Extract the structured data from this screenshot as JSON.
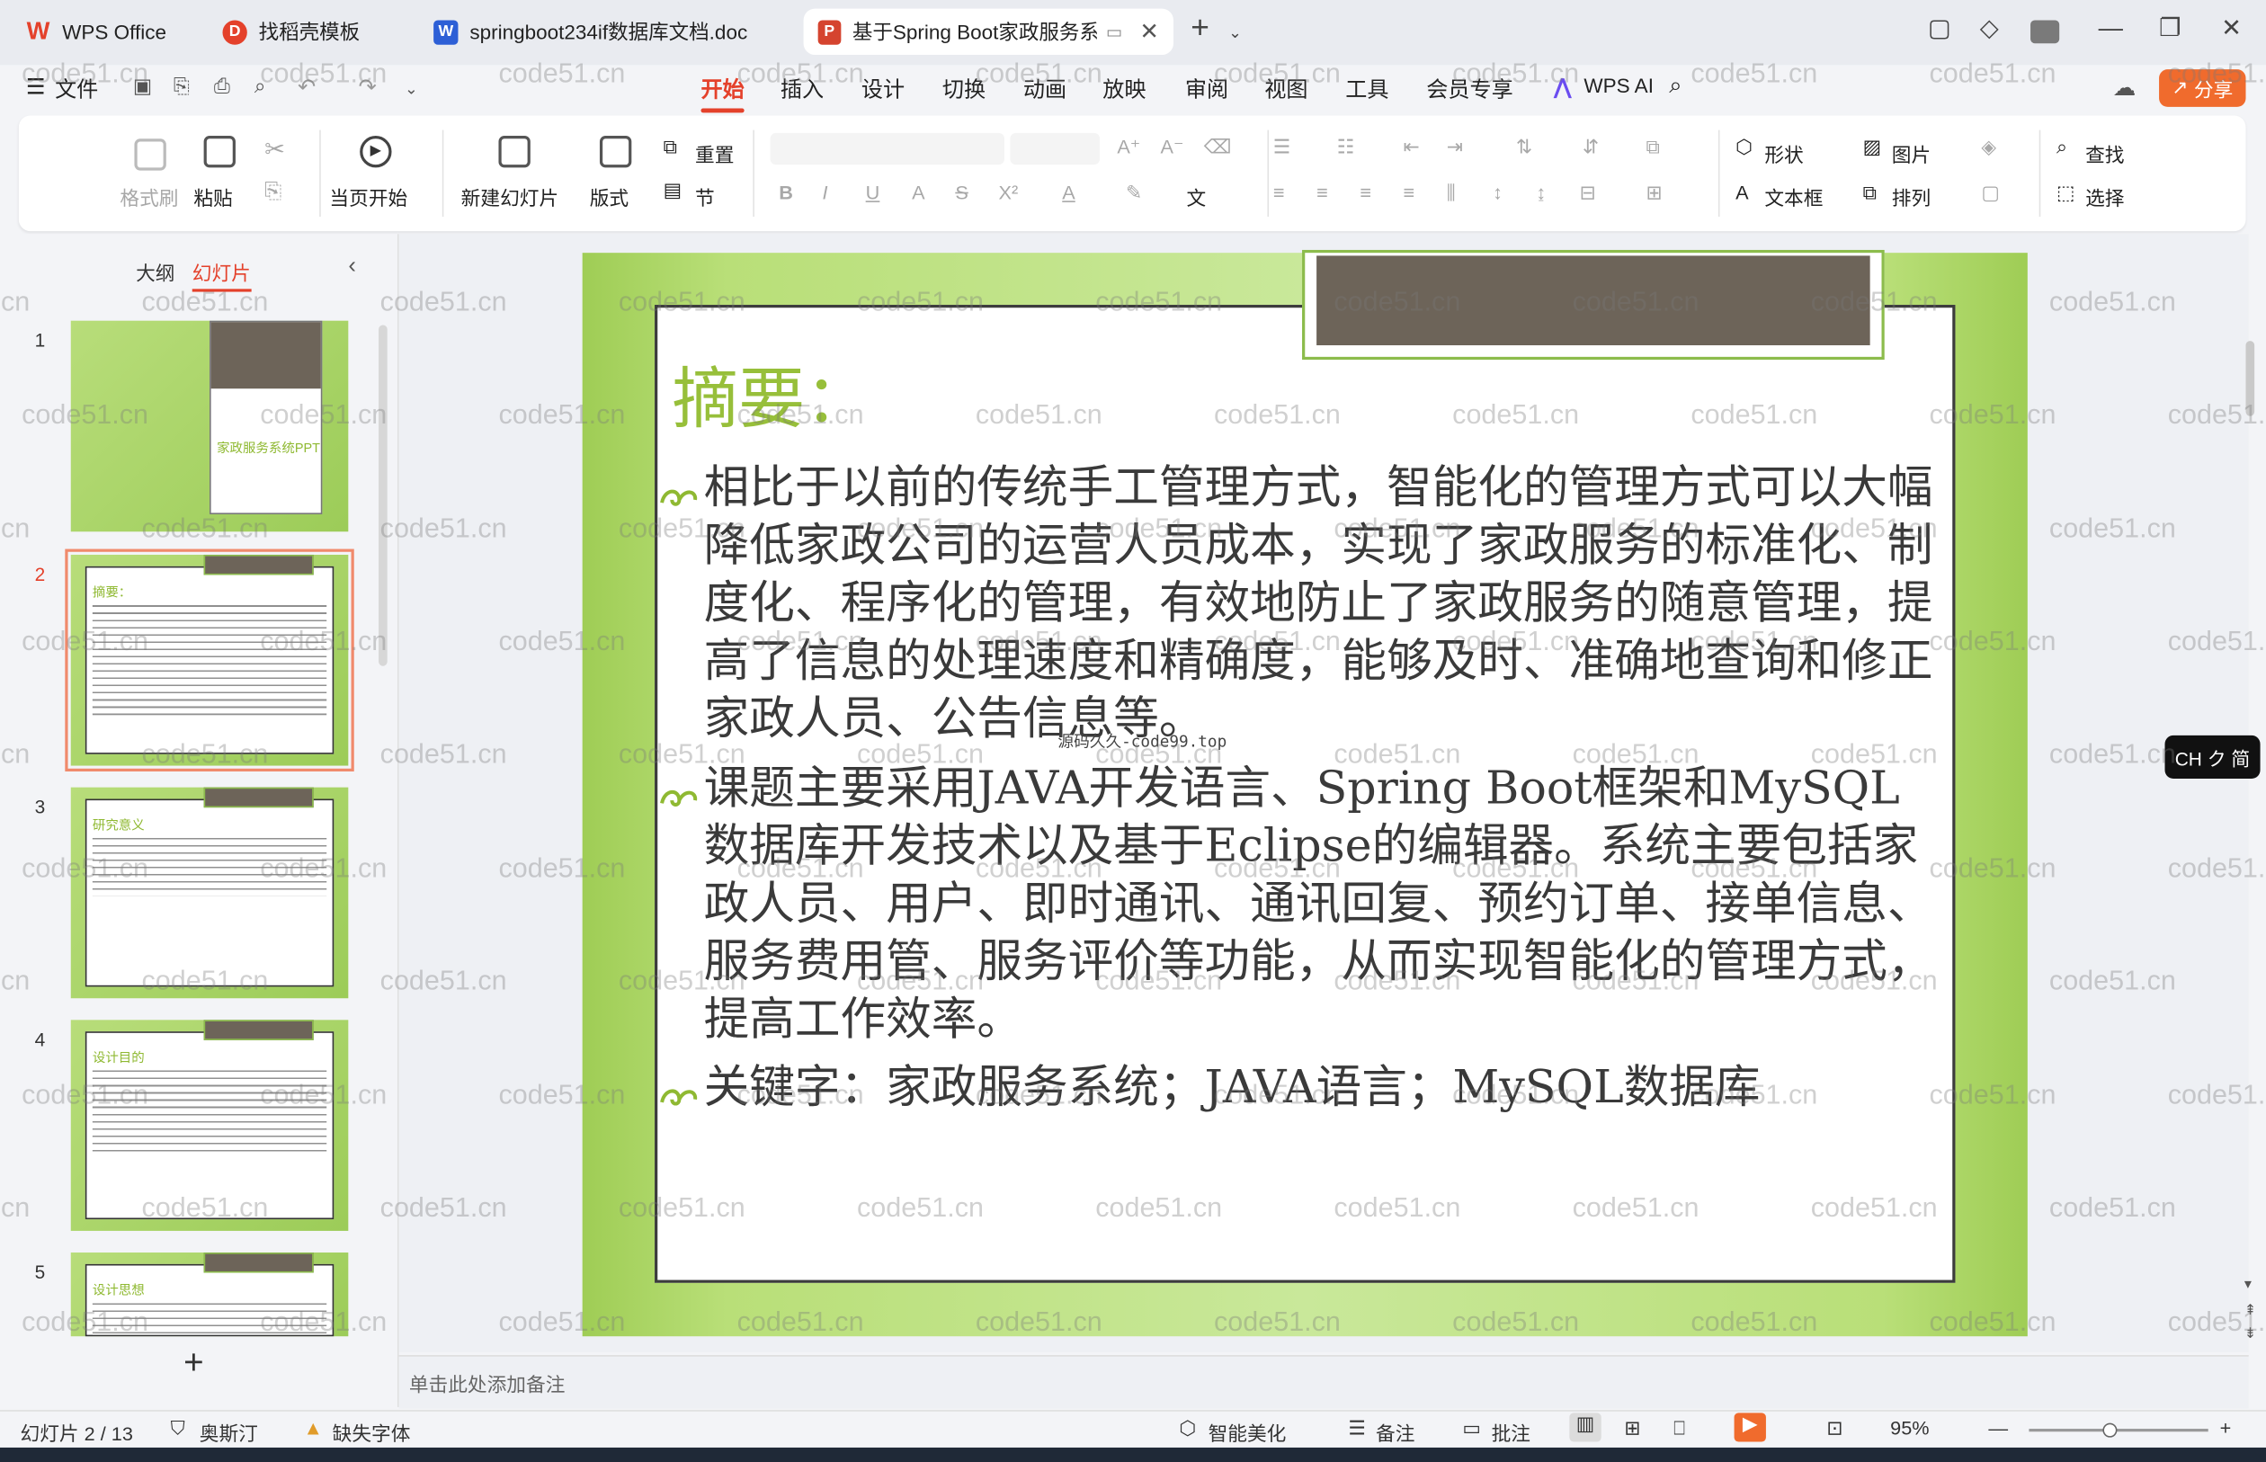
{
  "tabs": [
    {
      "label": "WPS Office",
      "icon": "wps-logo-icon",
      "color": "#e4412b"
    },
    {
      "label": "找稻壳模板",
      "icon": "docer-icon",
      "color": "#e4412b"
    },
    {
      "label": "springboot234if数据库文档.doc",
      "icon": "word-doc-icon",
      "color": "#2d5fd6"
    },
    {
      "label": "基于Spring Boot家政服务系...",
      "icon": "ppt-doc-icon",
      "color": "#d5442f"
    }
  ],
  "menu": {
    "file": "文件",
    "items": [
      "开始",
      "插入",
      "设计",
      "切换",
      "动画",
      "放映",
      "审阅",
      "视图",
      "工具",
      "会员专享"
    ],
    "ai": "WPS AI",
    "share": "分享"
  },
  "ribbon": {
    "format_painter": "格式刷",
    "paste": "粘贴",
    "play_from_current": "当页开始",
    "new_slide": "新建幻灯片",
    "layout": "版式",
    "reset": "重置",
    "section": "节",
    "shape": "形状",
    "picture": "图片",
    "textbox": "文本框",
    "arrange": "排列",
    "find": "查找",
    "select": "选择"
  },
  "leftpane": {
    "tab_outline": "大纲",
    "tab_slides": "幻灯片",
    "thumbs": [
      {
        "num": "1",
        "title": "家政服务系统PPT"
      },
      {
        "num": "2",
        "title": "摘要："
      },
      {
        "num": "3",
        "title": "研究意义"
      },
      {
        "num": "4",
        "title": "设计目的"
      },
      {
        "num": "5",
        "title": "设计思想"
      }
    ]
  },
  "slide": {
    "title": "摘要：",
    "paragraphs": [
      "相比于以前的传统手工管理方式，智能化的管理方式可以大幅降低家政公司的运营人员成本，实现了家政服务的标准化、制度化、程序化的管理，有效地防止了家政服务的随意管理，提高了信息的处理速度和精确度，能够及时、准确地查询和修正家政人员、公告信息等。",
      "课题主要采用JAVA开发语言、Spring Boot框架和MySQL数据库开发技术以及基于Eclipse的编辑器。系统主要包括家政人员、用户、即时通讯、通讯回复、预约订单、接单信息、服务费用管、服务评价等功能，从而实现智能化的管理方式，提高工作效率。",
      "关键字：家政服务系统；JAVA语言；MySQL数据库"
    ],
    "overlay_text": "源码久久-code99.top"
  },
  "notes_placeholder": "单击此处添加备注",
  "status": {
    "slide_counter": "幻灯片 2 / 13",
    "theme": "奥斯汀",
    "missing_font": "缺失字体",
    "beautify": "智能美化",
    "notes": "备注",
    "comments": "批注",
    "zoom": "95%"
  },
  "ime_badge": "CH ク 简",
  "watermark_text": "code51.cn"
}
